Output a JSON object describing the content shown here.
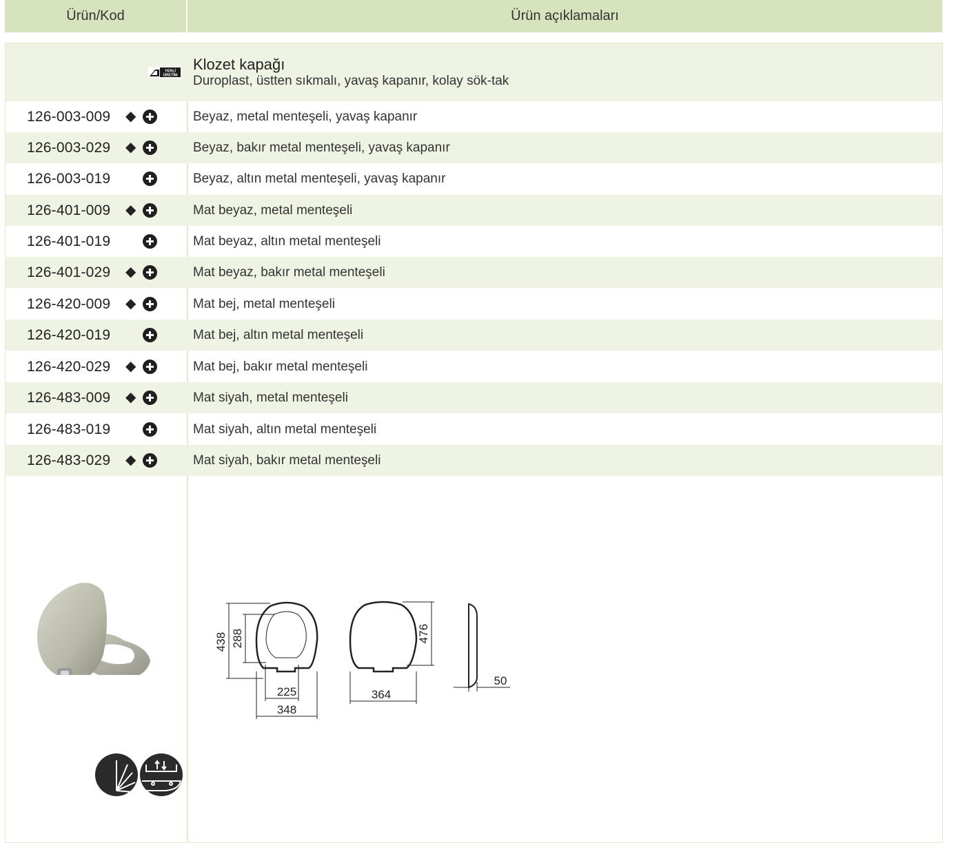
{
  "header": {
    "code_label": "Ürün/Kod",
    "desc_label": "Ürün açıklamaları"
  },
  "product": {
    "title": "Klozet kapağı",
    "subtitle": "Duroplast, üstten sıkmalı, yavaş kapanır, kolay sök-tak",
    "badge_text": "YERLİ ÜRETİM"
  },
  "rows": [
    {
      "code": "126-003-009",
      "diamond": "◆",
      "desc": "Beyaz, metal menteşeli, yavaş kapanır"
    },
    {
      "code": "126-003-029",
      "diamond": "◆",
      "desc": "Beyaz, bakır metal menteşeli, yavaş kapanır"
    },
    {
      "code": "126-003-019",
      "diamond": "",
      "desc": "Beyaz, altın metal menteşeli, yavaş kapanır"
    },
    {
      "code": "126-401-009",
      "diamond": "◆",
      "desc": "Mat beyaz, metal menteşeli"
    },
    {
      "code": "126-401-019",
      "diamond": "",
      "desc": "Mat beyaz, altın metal menteşeli"
    },
    {
      "code": "126-401-029",
      "diamond": "◆",
      "desc": "Mat beyaz, bakır metal menteşeli"
    },
    {
      "code": "126-420-009",
      "diamond": "◆",
      "desc": "Mat bej, metal menteşeli"
    },
    {
      "code": "126-420-019",
      "diamond": "",
      "desc": "Mat bej, altın metal menteşeli"
    },
    {
      "code": "126-420-029",
      "diamond": "◆",
      "desc": "Mat bej, bakır metal menteşeli"
    },
    {
      "code": "126-483-009",
      "diamond": "◆",
      "desc": "Mat siyah, metal menteşeli"
    },
    {
      "code": "126-483-019",
      "diamond": "",
      "desc": "Mat siyah, altın metal menteşeli"
    },
    {
      "code": "126-483-029",
      "diamond": "◆",
      "desc": "Mat siyah, bakır metal menteşeli"
    }
  ],
  "dimensions": {
    "d438": "438",
    "d288": "288",
    "d225": "225",
    "d348": "348",
    "d364": "364",
    "d476": "476",
    "d50": "50"
  },
  "colors": {
    "header_bg": "#d7e3bc",
    "row_alt_bg": "#eef3e3",
    "icon_dark": "#2b2b2b"
  },
  "icons": [
    "plus-circle-icon",
    "soft-close-icon",
    "quick-release-icon",
    "local-production-badge"
  ]
}
